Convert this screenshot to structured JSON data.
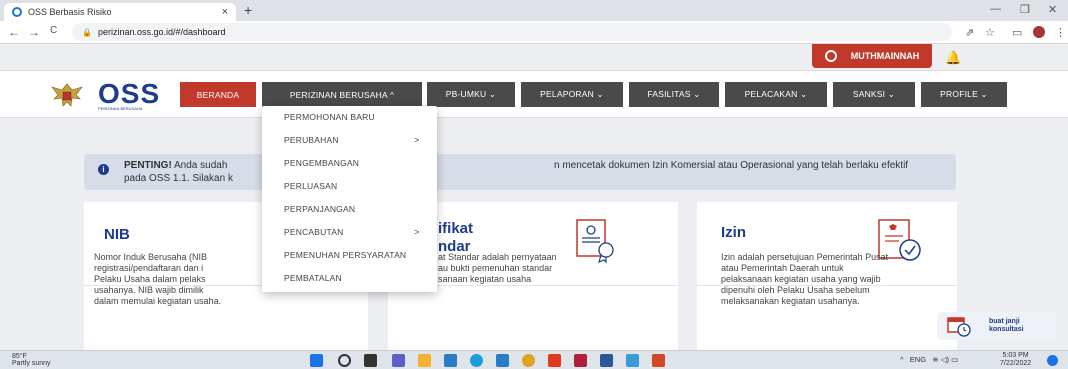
{
  "browser": {
    "tab_title": "OSS Berbasis Risiko",
    "tab_close": "×",
    "new_tab": "+",
    "url": "perizinan.oss.go.id/#/dashboard",
    "back": "←",
    "forward": "→",
    "reload": "C"
  },
  "userbar": {
    "username": "MUTHMAINNAH"
  },
  "header": {
    "logo_text": "OSS",
    "logo_subtext": "PERIZINAN BERUSAHA",
    "nav": [
      {
        "label": "BERANDA"
      },
      {
        "label": "PERIZINAN BERUSAHA ^"
      },
      {
        "label": "PB-UMKU ⌄"
      },
      {
        "label": "PELAPORAN ⌄"
      },
      {
        "label": "FASILITAS ⌄"
      },
      {
        "label": "PELACAKAN ⌄"
      },
      {
        "label": "SANKSI ⌄"
      },
      {
        "label": "PROFILE ⌄"
      }
    ]
  },
  "dropdown": {
    "items": [
      {
        "label": "PERMOHONAN BARU",
        "arrow": ""
      },
      {
        "label": "PERUBAHAN",
        "arrow": ">"
      },
      {
        "label": "PENGEMBANGAN",
        "arrow": ""
      },
      {
        "label": "PERLUASAN",
        "arrow": ""
      },
      {
        "label": "PERPANJANGAN",
        "arrow": ""
      },
      {
        "label": "PENCABUTAN",
        "arrow": ">"
      },
      {
        "label": "PEMENUHAN PERSYARATAN",
        "arrow": ""
      },
      {
        "label": "PEMBATALAN",
        "arrow": ""
      }
    ]
  },
  "alert": {
    "bold": "PENTING!",
    "line1": "Anda sudah",
    "line1b": "n mencetak dokumen Izin Komersial atau Operasional yang telah berlaku efektif",
    "line2": "pada OSS 1.1. Silakan k"
  },
  "cards": {
    "nib": {
      "title": "NIB",
      "desc": [
        "Nomor Induk Berusaha (NIB",
        "registrasi/pendaftaran dan i",
        "Pelaku Usaha dalam pelaks",
        "usahanya. NIB wajib dimilik",
        "dalam memulai kegiatan usaha."
      ]
    },
    "sertifikat": {
      "title1": "ifikat",
      "title2": "ndar",
      "desc": [
        "at Standar adalah pernyataan",
        "au bukti pemenuhan standar",
        "sanaan kegiatan usaha"
      ]
    },
    "izin": {
      "title": "Izin",
      "desc": [
        "Izin adalah persetujuan Pemerintah Pusat",
        "atau Pemerintah Daerah untuk",
        "pelaksanaan kegiatan usaha yang wajib",
        "dipenuhi oleh Pelaku Usaha sebelum",
        "melaksanakan kegiatan usahanya."
      ]
    }
  },
  "konsultasi": {
    "line1": "buat janji",
    "line2": "konsultasi"
  },
  "taskbar": {
    "temp": "85°F",
    "weather": "Partly sunny",
    "lang": "ENG",
    "time": "5:03 PM",
    "date": "7/22/2022"
  },
  "colors": {
    "accent_red": "#c0392b",
    "nav_dark": "#4a4a4a",
    "brand_blue": "#1d3c8c"
  }
}
